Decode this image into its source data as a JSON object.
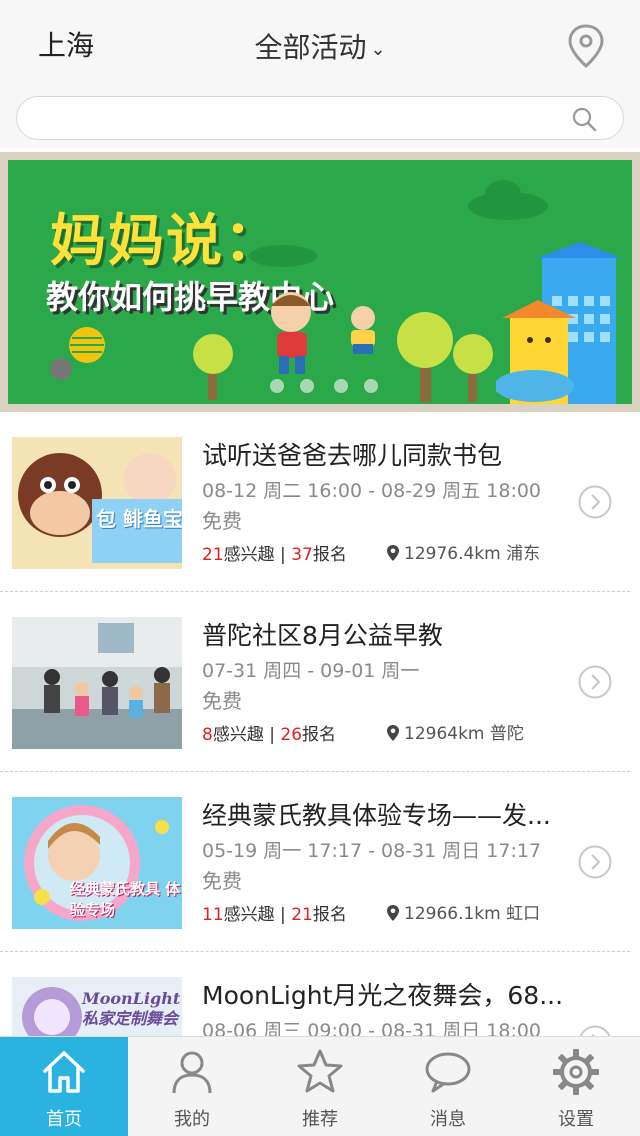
{
  "header": {
    "city": "上海",
    "category": "全部活动",
    "category_chevron": "chevron-down-icon",
    "location_icon": "map-pin-icon"
  },
  "search": {
    "placeholder": "",
    "icon": "search-icon"
  },
  "banner": {
    "title": "妈妈说：",
    "subtitle": "教你如何挑早教中心",
    "page_indicator": {
      "count": 4,
      "active": 1
    }
  },
  "events": [
    {
      "title": "试听送爸爸去哪儿同款书包",
      "time": "08-12 周二 16:00 - 08-29 周五 18:00",
      "price": "免费",
      "interested": "21",
      "interested_label": "感兴趣",
      "separator": "|",
      "signup": "37",
      "signup_label": "报名",
      "distance": "12976.4km 浦东",
      "thumb_text": "包 鲱鱼宝"
    },
    {
      "title": "普陀社区8月公益早教",
      "time": "07-31 周四 - 09-01 周一",
      "price": "免费",
      "interested": "8",
      "interested_label": "感兴趣",
      "separator": "|",
      "signup": "26",
      "signup_label": "报名",
      "distance": "12964km 普陀",
      "thumb_text": ""
    },
    {
      "title": "经典蒙氏教具体验专场——发...",
      "time": "05-19 周一 17:17 - 08-31 周日 17:17",
      "price": "免费",
      "interested": "11",
      "interested_label": "感兴趣",
      "separator": "|",
      "signup": "21",
      "signup_label": "报名",
      "distance": "12966.1km 虹口",
      "thumb_text": "经典蒙氏教具 体验专场"
    },
    {
      "title": "MoonLight月光之夜舞会，68...",
      "time": "08-06 周三 09:00 - 08-31 周日 18:00",
      "price": "",
      "interested": "",
      "interested_label": "",
      "separator": "",
      "signup": "",
      "signup_label": "",
      "distance": "",
      "thumb_text": "MoonLight 私家定制舞会"
    }
  ],
  "tabbar": [
    {
      "label": "首页",
      "icon": "home-icon",
      "active": true
    },
    {
      "label": "我的",
      "icon": "user-icon",
      "active": false
    },
    {
      "label": "推荐",
      "icon": "star-icon",
      "active": false
    },
    {
      "label": "消息",
      "icon": "chat-bubble-icon",
      "active": false
    },
    {
      "label": "设置",
      "icon": "gear-icon",
      "active": false
    }
  ],
  "colors": {
    "accent": "#2bb3e0",
    "highlight_number": "#e02020",
    "banner_green": "#2aa84a",
    "banner_title": "#ffe13a"
  }
}
